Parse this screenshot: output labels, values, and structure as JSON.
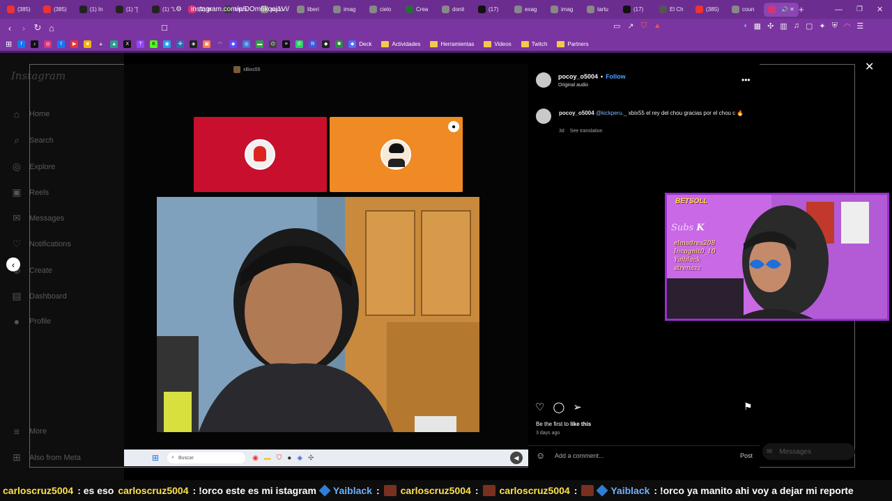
{
  "browser": {
    "tabs": [
      {
        "label": "(385)",
        "color": "#e33"
      },
      {
        "label": "(385)",
        "color": "#e33"
      },
      {
        "label": "(1) In",
        "color": "#222"
      },
      {
        "label": "(1) \"[",
        "color": "#222"
      },
      {
        "label": "(1) \"L",
        "color": "#222"
      },
      {
        "label": "(1) In",
        "color": "#d4357a"
      },
      {
        "label": "betm",
        "color": "#3a3a3a"
      },
      {
        "label": "sudo",
        "color": "#888"
      },
      {
        "label": "liberi",
        "color": "#888"
      },
      {
        "label": "imag",
        "color": "#888"
      },
      {
        "label": "cielo",
        "color": "#888"
      },
      {
        "label": "Crea",
        "color": "#2d6b3f"
      },
      {
        "label": "donit",
        "color": "#888"
      },
      {
        "label": "(17)",
        "color": "#111"
      },
      {
        "label": "exag",
        "color": "#888"
      },
      {
        "label": "imag",
        "color": "#888"
      },
      {
        "label": "tartu",
        "color": "#888"
      },
      {
        "label": "(17)",
        "color": "#111"
      },
      {
        "label": "El Ch",
        "color": "#555"
      },
      {
        "label": "(385)",
        "color": "#e33"
      },
      {
        "label": "coun",
        "color": "#888"
      },
      {
        "label": "",
        "color": "#d4357a"
      }
    ],
    "url": "instagram.com/p/DOm6kqoj1Vi/",
    "bookmarks": {
      "deck": "Deck",
      "folders": [
        "Actividades",
        "Herramientas",
        "Videos",
        "Twitch",
        "Partners"
      ]
    }
  },
  "instagram": {
    "logo": "Instagram",
    "nav": [
      {
        "label": "Home",
        "icon": "home-icon",
        "glyph": "⌂"
      },
      {
        "label": "Search",
        "icon": "search-icon",
        "glyph": "⌕"
      },
      {
        "label": "Explore",
        "icon": "compass-icon",
        "glyph": "◎"
      },
      {
        "label": "Reels",
        "icon": "reels-icon",
        "glyph": "▣"
      },
      {
        "label": "Messages",
        "icon": "messenger-icon",
        "glyph": "✉"
      },
      {
        "label": "Notifications",
        "icon": "heart-icon",
        "glyph": "♡"
      },
      {
        "label": "Create",
        "icon": "plus-square-icon",
        "glyph": "⊕"
      },
      {
        "label": "Dashboard",
        "icon": "chart-icon",
        "glyph": "▤"
      },
      {
        "label": "Profile",
        "icon": "profile-avatar-icon",
        "glyph": "●"
      }
    ],
    "more": "More",
    "also_from_meta": "Also from Meta"
  },
  "video": {
    "top_name": "xBixs55",
    "taskbar_search": "Buscar"
  },
  "post": {
    "username": "pocoy_o5004",
    "separator": "•",
    "follow": "Follow",
    "audio": "Original audio",
    "comment_user": "pocoy_o5004",
    "mention": "@kickperu._",
    "comment_text": "xbix55 el rey del chou gracias por el chou c",
    "comment_age": "3d",
    "see_translation": "See translation",
    "likes_text": "Be the first to ",
    "likes_bold": "like this",
    "date": "3 days ago",
    "add_comment_placeholder": "Add a comment...",
    "post_button": "Post",
    "messages": "Messages"
  },
  "stream_overlay": {
    "brand": "BETSOLL",
    "subs_label": "Subs",
    "names": [
      "elmadres208",
      "Incognit0_10",
      "Yaiblack",
      "strenazz"
    ]
  },
  "chat": [
    {
      "user": "carloscruz5004",
      "msg": ": es eso",
      "badge": null,
      "emote": false
    },
    {
      "user": "carloscruz5004",
      "msg": ": !orco este es mi istagram",
      "badge": null,
      "emote": false
    },
    {
      "user": "Yaiblack",
      "msg": ":",
      "badge": "cube",
      "emote": true
    },
    {
      "user": "carloscruz5004",
      "msg": ":",
      "badge": null,
      "emote": true
    },
    {
      "user": "carloscruz5004",
      "msg": ":",
      "badge": null,
      "emote": true
    },
    {
      "user": "Yaiblack",
      "msg": ": !orco ya manito ahi voy a dejar mi reporte",
      "badge": "cube",
      "emote": false
    }
  ]
}
